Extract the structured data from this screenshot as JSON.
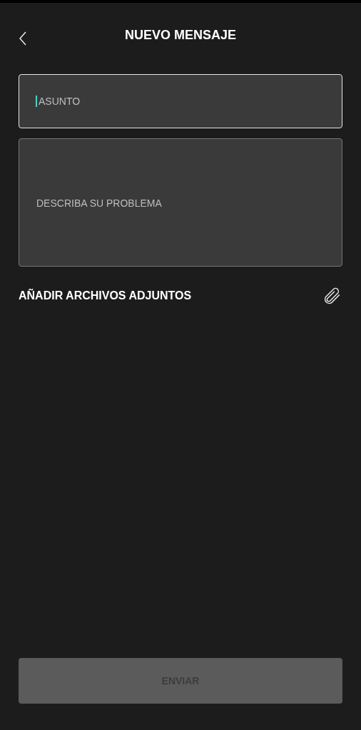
{
  "header": {
    "title": "NUEVO MENSAJE"
  },
  "subject_field": {
    "placeholder": "ASUNTO",
    "focused": true
  },
  "description_field": {
    "placeholder": "DESCRIBA SU PROBLEMA",
    "focused": false
  },
  "attachments": {
    "label": "AÑADIR ARCHIVOS ADJUNTOS"
  },
  "send_button": {
    "label": "ENVIAR",
    "disabled": true
  }
}
